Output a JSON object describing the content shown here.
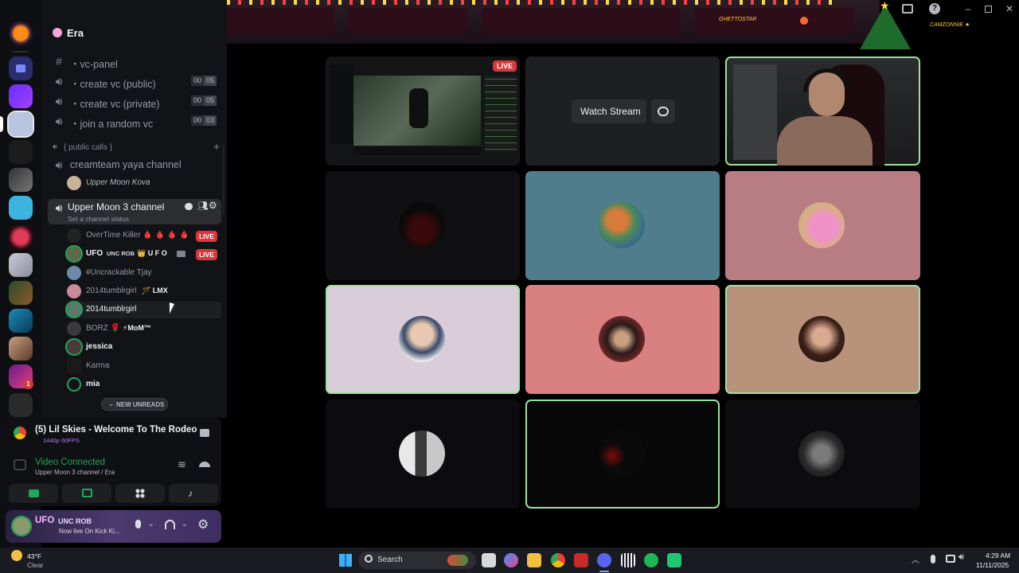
{
  "server": {
    "name": "Era"
  },
  "channels": {
    "vc_panel": "・vc-panel",
    "create_public": {
      "label": "・create vc (public)",
      "count": "00",
      "max": "05"
    },
    "create_private": {
      "label": "・create vc (private)",
      "count": "00",
      "max": "05"
    },
    "join_random": {
      "label": "・join a random vc",
      "count": "00",
      "max": "03"
    },
    "category": "{ public calls }",
    "creamteam": "creamteam yaya channel",
    "creamteam_user": "Upper Moon Kova",
    "active_channel": "Upper Moon 3 channel",
    "channel_status": "Set a channel status"
  },
  "voice_users": [
    {
      "name": "OverTime Killer 🩸 🩸 🩸 🩸",
      "live": "LIVE"
    },
    {
      "name": "UFO",
      "tag": "UNC ROB",
      "extra": "👑 U F O",
      "live": "LIVE"
    },
    {
      "name": "#Uncrackable Tjay"
    },
    {
      "name": "2014tumblrgirl",
      "extra": "🪄 LMX"
    },
    {
      "name": "2014tumblrgirl"
    },
    {
      "name": "BORZ 🌹",
      "extra": "⚡MoM™"
    },
    {
      "name": "jessica"
    },
    {
      "name": "Karma"
    },
    {
      "name": "mia"
    }
  ],
  "new_unreads": "NEW UNREADS",
  "stream_notice": {
    "title": "(5) Lil Skies - Welcome To The Rodeo ...",
    "quality": "1440p 60FPS"
  },
  "voice_status": {
    "title": "Video Connected",
    "subtitle": "Upper Moon 3 channel / Era"
  },
  "user_panel": {
    "name": "UFO",
    "tag": "UNC ROB",
    "status": "Now live On Kick Ki..."
  },
  "stage": {
    "live_label": "LIVE",
    "watch_stream": "Watch Stream"
  },
  "banner": {
    "left_name": "GHETTOSTAR",
    "right_name": "CAMZONNIE ★"
  },
  "taskbar": {
    "search_placeholder": "Search",
    "weather_temp": "43°F",
    "weather_desc": "Clear",
    "time": "4:29 AM",
    "date": "11/11/2025"
  },
  "colors": {
    "accent_green": "#23a55a",
    "live_red": "#da373c",
    "speaking_ring": "#9ae29a",
    "tile_teal": "#4f7d8c",
    "tile_rose": "#b87d83",
    "tile_lilac": "#d8cdd9",
    "tile_salmon": "#d98180",
    "tile_tan": "#b8927a"
  }
}
